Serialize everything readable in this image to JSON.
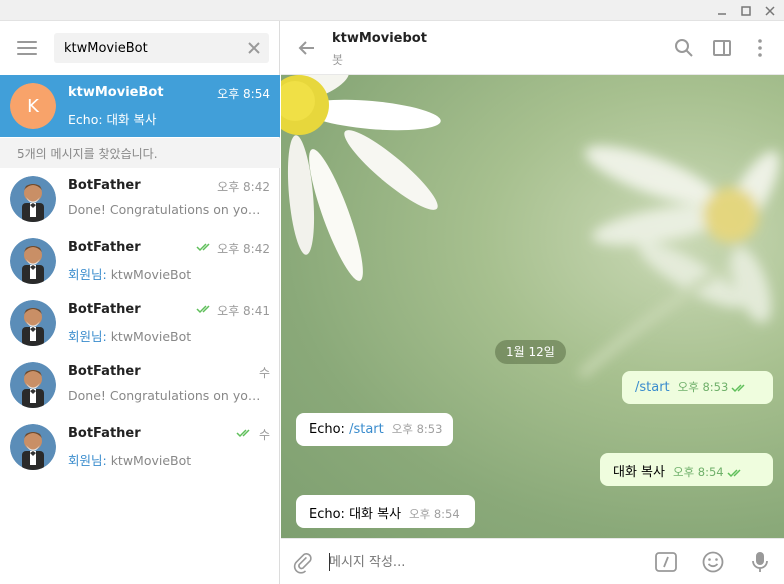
{
  "search": {
    "value": "ktwMovieBot"
  },
  "found_text": "5개의 메시지를 찾았습니다.",
  "chats": [
    {
      "name": "ktwMovieBot",
      "time": "오후 8:54",
      "sender": "",
      "preview": "Echo: 대화 복사",
      "avatar_letter": "K",
      "avatar_color": "#f8a36a"
    },
    {
      "name": "BotFather",
      "time": "오후 8:42",
      "sender": "",
      "preview": "Done! Congratulations on your ..."
    },
    {
      "name": "BotFather",
      "time": "오후 8:42",
      "sender": "회원님:",
      "preview": " ktwMovieBot"
    },
    {
      "name": "BotFather",
      "time": "오후 8:41",
      "sender": "회원님:",
      "preview": " ktwMovieBot"
    },
    {
      "name": "BotFather",
      "time": "수",
      "sender": "",
      "preview": "Done! Congratulations on your ..."
    },
    {
      "name": "BotFather",
      "time": "수",
      "sender": "회원님:",
      "preview": " ktwMovieBot"
    }
  ],
  "header": {
    "title": "ktwMoviebot",
    "subtitle": "봇"
  },
  "date_label": "1월 12일",
  "messages": [
    {
      "prefix": "",
      "cmd": "/start",
      "time": "오후 8:53"
    },
    {
      "prefix": "Echo: ",
      "cmd": "/start",
      "time": "오후 8:53"
    },
    {
      "prefix": "대화 복사",
      "cmd": "",
      "time": "오후 8:54"
    },
    {
      "prefix": "Echo: 대화 복사",
      "cmd": "",
      "time": "오후 8:54"
    }
  ],
  "composer": {
    "placeholder": "메시지 작성..."
  },
  "colors": {
    "accent": "#419fd9",
    "outgoing_bubble": "#effdde",
    "check": "#5fbf5a"
  }
}
